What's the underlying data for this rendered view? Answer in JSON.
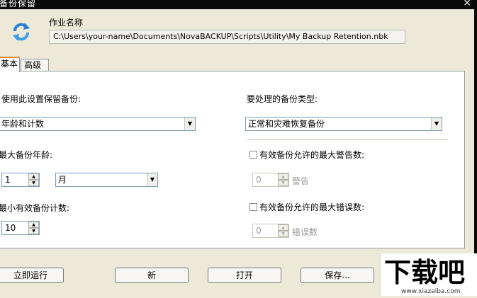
{
  "window": {
    "title": "备份保留",
    "close_glyph": "×"
  },
  "job": {
    "label": "作业名称",
    "path": "C:\\Users\\your-name\\Documents\\NovaBACKUP\\Scripts\\Utility\\My Backup Retention.nbk",
    "icon": "refresh-arrows-icon"
  },
  "tabs": [
    {
      "label": "基本",
      "active": true
    },
    {
      "label": "高级",
      "active": false
    }
  ],
  "basic": {
    "retain_label": "使用此设置保留备份:",
    "retain_value": "年龄和计数",
    "types_label": "要处理的备份类型:",
    "types_value": "正常和灾难恢复备份",
    "max_age_label": "最大备份年龄:",
    "max_age_value": "1",
    "max_age_unit": "月",
    "min_count_label": "最小有效备份计数:",
    "min_count_value": "10",
    "max_warn_label": "有效备份允许的最大警告数:",
    "max_warn_value": "0",
    "warn_unit": "警告",
    "max_err_label": "有效备份允许的最大错误数:",
    "max_err_value": "0",
    "err_unit": "错误数"
  },
  "buttons": {
    "run_now": "立即运行",
    "new": "新",
    "open": "打开",
    "save": "保存..."
  },
  "watermark": {
    "text": "下载吧",
    "url": "www.xiazaiba.com"
  }
}
